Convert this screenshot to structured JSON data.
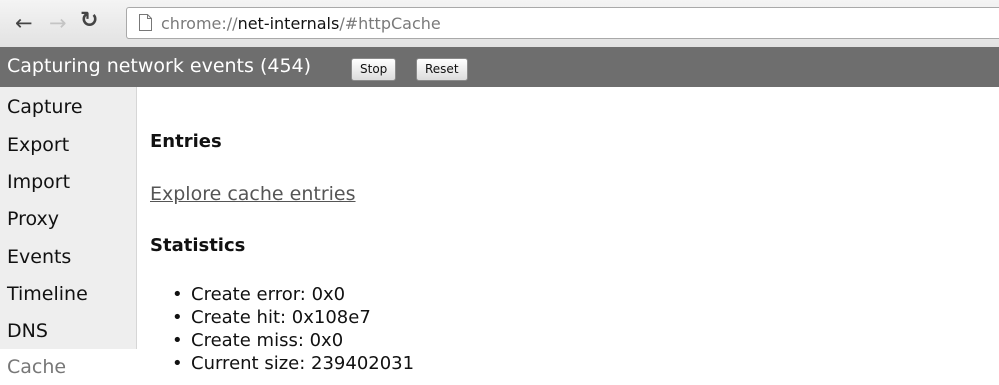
{
  "browser": {
    "icons": {
      "back": "back-arrow-icon",
      "forward": "forward-arrow-icon",
      "reload": "reload-icon",
      "page": "page-icon"
    },
    "url_scheme": "chrome://",
    "url_host": "net-internals",
    "url_path": "/#httpCache"
  },
  "status": {
    "text": "Capturing network events (454)",
    "stop_label": "Stop",
    "reset_label": "Reset"
  },
  "sidebar": {
    "items": [
      {
        "label": "Capture"
      },
      {
        "label": "Export"
      },
      {
        "label": "Import"
      },
      {
        "label": "Proxy"
      },
      {
        "label": "Events"
      },
      {
        "label": "Timeline"
      },
      {
        "label": "DNS"
      },
      {
        "label": "Cache",
        "active": true
      }
    ]
  },
  "main": {
    "entries_heading": "Entries",
    "explore_link": "Explore cache entries",
    "statistics_heading": "Statistics",
    "stats": [
      "Create error: 0x0",
      "Create hit: 0x108e7",
      "Create miss: 0x0",
      "Current size: 239402031"
    ]
  },
  "colors": {
    "status_bar": "#6e6e6e",
    "sidebar_bg": "#eeeeee",
    "link": "#555555"
  }
}
